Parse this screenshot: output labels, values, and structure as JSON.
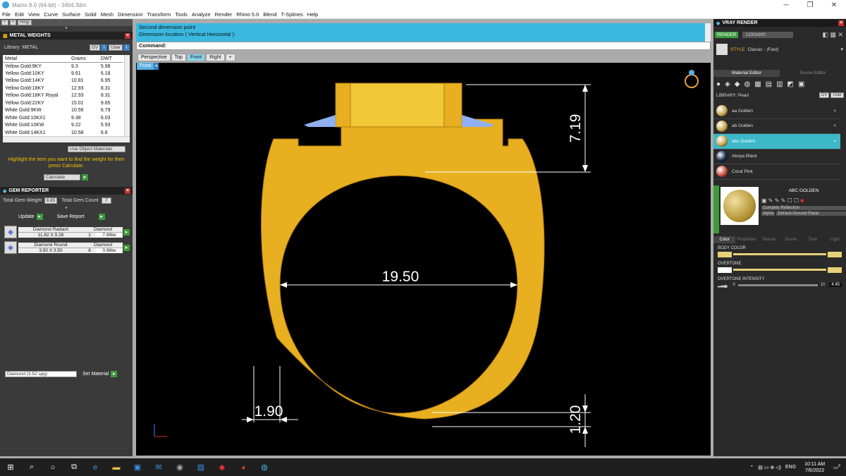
{
  "window": {
    "title": "Matrix 8.0 (64-bit) - 3464.3dm"
  },
  "menu": [
    "File",
    "Edit",
    "View",
    "Curve",
    "Surface",
    "Solid",
    "Mesh",
    "Dimension",
    "Transform",
    "Tools",
    "Analyze",
    "Render",
    "Rhino 5.0",
    "Blend",
    "T-Splines",
    "Help"
  ],
  "left_top": {
    "hinge_label": "Hingi"
  },
  "metal": {
    "title": "METAL WEIGHTS",
    "library": "Library: METAL",
    "gv": "GV",
    "user": "User",
    "headers": [
      "Metal",
      "Grams",
      "DWT"
    ],
    "rows": [
      [
        "Yellow Gold:9KY",
        "9.3",
        "5.98"
      ],
      [
        "Yellow Gold:10KY",
        "9.61",
        "6.18"
      ],
      [
        "Yellow Gold:14KY",
        "10.81",
        "6.95"
      ],
      [
        "Yellow Gold:18KY",
        "12.93",
        "8.31"
      ],
      [
        "Yellow Gold:18KY Royal",
        "12.93",
        "8.31"
      ],
      [
        "Yellow Gold:22KY",
        "15.01",
        "9.65"
      ],
      [
        "White Gold:9KW",
        "10.56",
        "6.79"
      ],
      [
        "White Gold:10KX1",
        "9.38",
        "6.03"
      ],
      [
        "White Gold:10KW",
        "9.22",
        "5.93"
      ],
      [
        "White Gold:14KX1",
        "10.58",
        "6.8"
      ]
    ],
    "use_object": "Use Object Materials",
    "hint": "Highlight the item you want to find the weight for then press Calculate.",
    "calculate": "Calculate"
  },
  "gem": {
    "title": "GEM REPORTER",
    "total_weight_label": "Total Gem Weight",
    "total_weight": "8.85",
    "total_count_label": "Total Gem Count",
    "total_count": "7",
    "update": "Update",
    "save": "Save Report",
    "items": [
      {
        "name": "Diamond Radiant",
        "size": "11.82 X 9.28",
        "type": "Diamond",
        "count": "1",
        "weight": "7.88tw"
      },
      {
        "name": "Diamond Round",
        "size": "3.50 X 3.50",
        "type": "Diamond",
        "count": "6",
        "weight": "0.96tw"
      }
    ],
    "select": "Diamond    (3.52 spg)",
    "set_material": "Set Material"
  },
  "command": {
    "line1": "Second dimension point",
    "line2": "Dimension location ( Vertical  Horizontal ):",
    "prompt": "Command:"
  },
  "viewtabs": [
    "Perspective",
    "Top",
    "Front",
    "Right"
  ],
  "viewport_label": "Front",
  "dims": {
    "height": "7.19",
    "width": "19.50",
    "wall": "1.90",
    "bottom": "1.20"
  },
  "vray": {
    "title": "VRAY RENDER",
    "render": "RENDER",
    "resolution": "1200x900",
    "style_label": "STYLE",
    "style": "Classic - (Fast)",
    "tabs": [
      "Material Editor",
      "Scene Editor"
    ],
    "library": "LIBRARY: Pearl",
    "gv": "GV",
    "user": "User",
    "materials": [
      {
        "name": "aa Golden",
        "color": "#c8a84a"
      },
      {
        "name": "ab Golden",
        "color": "#c8a84a"
      },
      {
        "name": "abc Golden",
        "color": "#c8a84a"
      },
      {
        "name": "Akoya Black",
        "color": "#1a2a4a"
      },
      {
        "name": "Coral Pink",
        "color": "#d05040"
      }
    ],
    "selected_name": "ABC GOLDEN",
    "reflection": "Complex Reflection",
    "alpha": "Alpha",
    "ground": "Default-Ground Plane",
    "proptabs": [
      "Color",
      "Properties",
      "Texture",
      "Scene",
      "Toon",
      "Light"
    ],
    "body_color": "BODY COLOR",
    "overtone": "OVERTONE",
    "intensity_label": "OVERTONE INTENSITY",
    "int_min": "0",
    "int_max": "10",
    "intensity": "4.45"
  },
  "taskbar": {
    "lang": "ENG",
    "time": "10:11 AM",
    "date": "7/6/2022",
    "notif": "2"
  },
  "colors": {
    "gold": "#e8b020",
    "accent": "#3cb8e0"
  }
}
